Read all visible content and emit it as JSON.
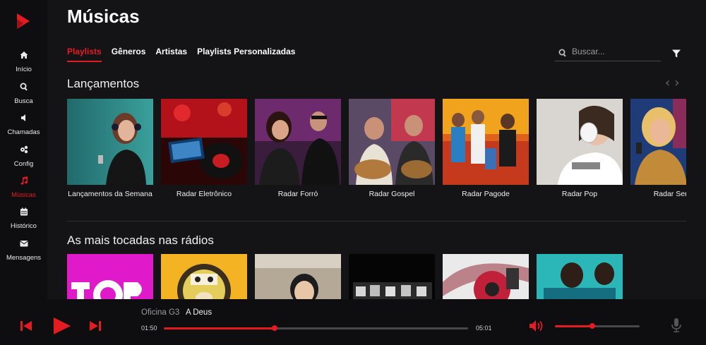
{
  "app": {
    "page_title": "Músicas",
    "accent_color": "#e51b22"
  },
  "sidebar": {
    "items": [
      {
        "label": "Início",
        "icon": "home-icon"
      },
      {
        "label": "Busca",
        "icon": "search-icon"
      },
      {
        "label": "Chamadas",
        "icon": "speaker-icon"
      },
      {
        "label": "Config",
        "icon": "gears-icon"
      },
      {
        "label": "Músicas",
        "icon": "music-note-icon",
        "active": true
      },
      {
        "label": "Histórico",
        "icon": "calendar-icon"
      },
      {
        "label": "Mensagens",
        "icon": "envelope-icon"
      }
    ]
  },
  "tabs": [
    "Playlists",
    "Gêneros",
    "Artistas",
    "Playlists Personalizadas"
  ],
  "search": {
    "placeholder": "Buscar..."
  },
  "sections": {
    "lancamentos": {
      "title": "Lançamentos",
      "cards": [
        "Lançamentos da Semana",
        "Radar Eletrônico",
        "Radar Forró",
        "Radar Gospel",
        "Radar Pagode",
        "Radar Pop",
        "Radar Serta"
      ]
    },
    "radios": {
      "title": "As mais tocadas nas rádios"
    }
  },
  "player": {
    "artist": "Oficina G3",
    "track": "A Deus",
    "elapsed": "01:50",
    "duration": "05:01",
    "progress": 0.365,
    "volume": 0.44
  }
}
